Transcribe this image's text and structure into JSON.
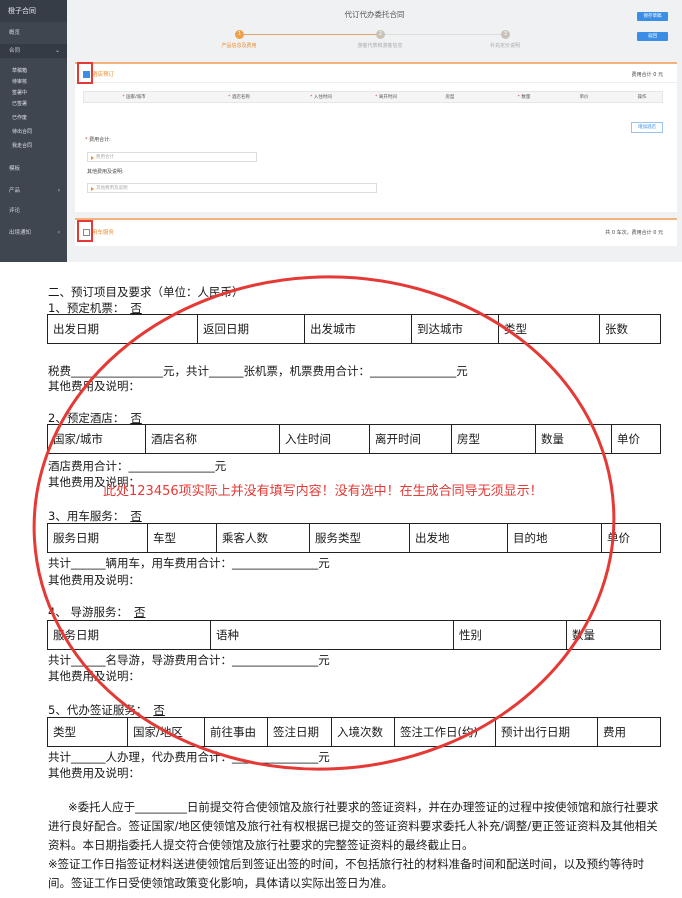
{
  "sidebar": {
    "logo": "橙子合同",
    "items": [
      {
        "label": "概览"
      },
      {
        "label": "合同"
      },
      {
        "label": "模板"
      },
      {
        "label": "产品"
      },
      {
        "label": "评论"
      },
      {
        "label": "出境通知"
      }
    ],
    "sub_items": [
      {
        "label": "草稿箱"
      },
      {
        "label": "待审核"
      },
      {
        "label": "签署中"
      },
      {
        "label": "已签署"
      },
      {
        "label": "已作废"
      },
      {
        "label": "待出合同"
      },
      {
        "label": "我走合同"
      }
    ]
  },
  "header": {
    "title": "代订代办委托合同",
    "save_button": "保存草稿",
    "back_button": "返回"
  },
  "steps": [
    {
      "num": "1",
      "label": "产品信息及费用"
    },
    {
      "num": "2",
      "label": "游客代表和游客信息"
    },
    {
      "num": "3",
      "label": "补充定价说明"
    }
  ],
  "hotel_panel": {
    "title": "酒店预订",
    "fee_total": "费用合计 0 元",
    "columns": [
      "国家/城市",
      "酒店名称",
      "入住时间",
      "离开时间",
      "房型",
      "数量",
      "单价",
      "操作"
    ],
    "required": [
      true,
      true,
      true,
      true,
      false,
      true,
      false,
      false
    ],
    "add_button": "增加酒店",
    "fee_label": "费用合计:",
    "fee_placeholder": "费用合计",
    "other_label": "其他费用及说明:",
    "other_placeholder": "其他费用及说明"
  },
  "car_panel": {
    "title": "用车服务",
    "summary": "共 0 车次，费用合计 0 元"
  },
  "doc": {
    "section_title": "二、预订项目及要求（单位：人民币）",
    "flight": {
      "heading": "1、预定机票：",
      "value": "否",
      "columns": [
        "出发日期",
        "返回日期",
        "出发城市",
        "到达城市",
        "类型",
        "张数"
      ],
      "tax_line": "税费________________元，共计______张机票，机票费用合计：_______________元",
      "other": "其他费用及说明："
    },
    "hotel": {
      "heading": "2、预定酒店：",
      "value": "否",
      "columns": [
        "国家/城市",
        "酒店名称",
        "入住时间",
        "离开时间",
        "房型",
        "数量",
        "单价"
      ],
      "fee_line": "酒店费用合计：_______________元",
      "other": "其他费用及说明："
    },
    "car": {
      "heading": "3、用车服务：",
      "value": "否",
      "columns": [
        "服务日期",
        "车型",
        "乘客人数",
        "服务类型",
        "出发地",
        "目的地",
        "单价"
      ],
      "fee_line": "共计______辆用车，用车费用合计：_______________元",
      "other": "其他费用及说明："
    },
    "guide": {
      "heading": "4、  导游服务：",
      "value": "否",
      "columns": [
        "服务日期",
        "语种",
        "性别",
        "数量"
      ],
      "fee_line": "共计______名导游，导游费用合计：_______________元",
      "other": "其他费用及说明："
    },
    "visa": {
      "heading": "5、代办签证服务：",
      "value": "否",
      "columns": [
        "类型",
        "国家/地区",
        "前往事由",
        "签注日期",
        "入境次数",
        "签注工作日(约)",
        "预计出行日期",
        "费用"
      ],
      "fee_line": "共计______人办理，代办费用合计：_______________元",
      "other": "其他费用及说明："
    },
    "notes": [
      "※委托人应于_________日前提交符合使领馆及旅行社要求的签证资料，并在办理签证的过程中按使领馆和旅行社要求进行良好配合。签证国家/地区使领馆及旅行社有权根据已提交的签证资料要求委托人补充/调整/更正签证资料及其他相关资料。本日期指委托人提交符合使领馆及旅行社要求的完整签证资料的最终截止日。",
      "※签证工作日指签证材料送进使领馆后到签证出签的时间，不包括旅行社的材料准备时间和配送时间，以及预约等待时间。签证工作日受使领馆政策变化影响，具体请以实际出签日为准。"
    ]
  },
  "annotation": "此处123456项实际上并没有填写内容！没有选中！在生成合同导无须显示！",
  "colors": {
    "annotation_red": "#e53935",
    "accent_orange": "#f08c2e",
    "button_blue": "#3a8ee6"
  }
}
